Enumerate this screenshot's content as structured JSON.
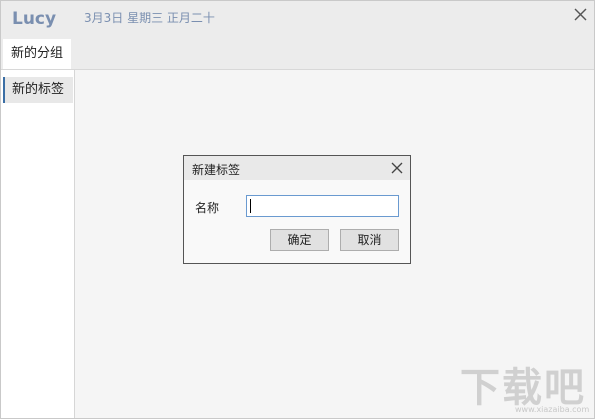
{
  "titlebar": {
    "app_name": "Lucy",
    "date": "3月3日 星期三 正月二十"
  },
  "tabs": [
    {
      "label": "新的分组",
      "active": true
    }
  ],
  "sidebar": {
    "items": [
      {
        "label": "新的标签",
        "selected": true
      }
    ]
  },
  "dialog": {
    "title": "新建标签",
    "name_label": "名称",
    "name_value": "",
    "ok_label": "确定",
    "cancel_label": "取消"
  },
  "watermark": {
    "text": "下载吧",
    "subtext": "www.xiazaiba.com"
  },
  "colors": {
    "accent_text": "#7a8fb0",
    "selection_bar": "#3a6ea5",
    "input_border": "#6a9ad0"
  },
  "icons": {
    "window_close": "close-icon",
    "dialog_close": "close-icon"
  }
}
